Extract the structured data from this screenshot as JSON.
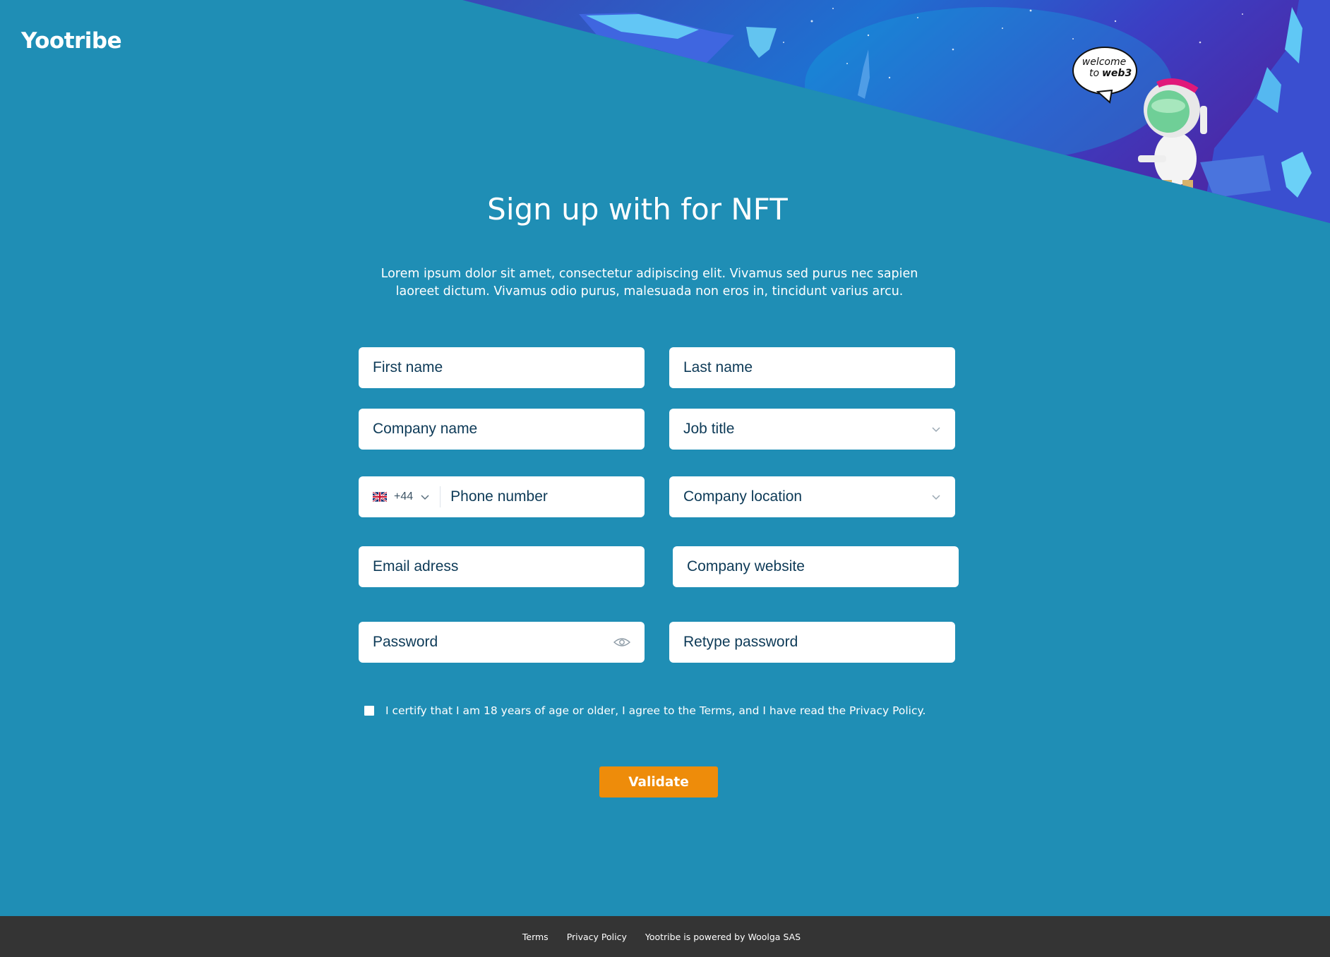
{
  "brand": {
    "name": "Yootribe"
  },
  "hero": {
    "bubble_line1": "welcome",
    "bubble_line2": "to",
    "bubble_line3": "web3"
  },
  "page": {
    "title": "Sign up with for NFT",
    "intro": "Lorem ipsum dolor sit amet, consectetur adipiscing elit. Vivamus sed purus nec sapien laoreet dictum. Vivamus odio purus, malesuada non eros in, tincidunt varius arcu."
  },
  "form": {
    "first_name": "First name",
    "last_name": "Last name",
    "company_name": "Company name",
    "job_title": "Job title",
    "phone_code": "+44",
    "phone_flag": "uk-flag-icon",
    "phone_number": "Phone number",
    "company_location": "Company location",
    "email": "Email adress",
    "company_website": "Company website",
    "password": "Password",
    "retype_password": "Retype password",
    "certify": "I certify that I am 18 years of age or older, I agree to the Terms, and I have read the Privacy Policy.",
    "submit": "Validate"
  },
  "footer": {
    "terms": "Terms",
    "privacy": "Privacy Policy",
    "powered": "Yootribe is powered by Woolga SAS"
  },
  "colors": {
    "background": "#1f8eb5",
    "button": "#ee8c0a",
    "footer": "#343434",
    "field_text": "#0d3a57"
  }
}
